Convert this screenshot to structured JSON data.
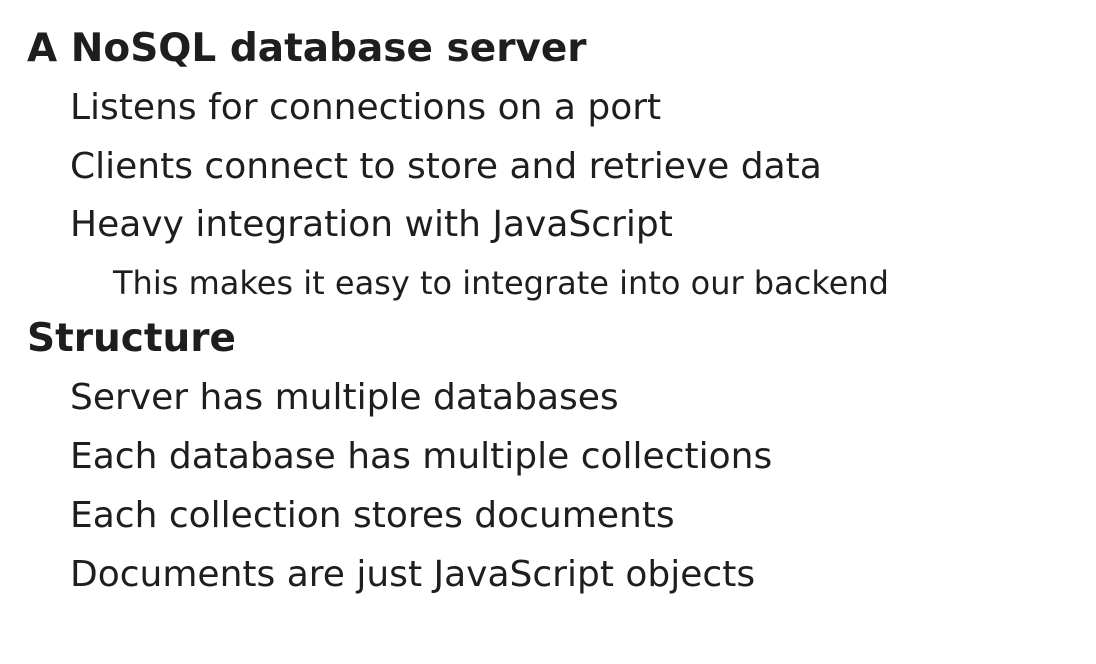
{
  "sections": [
    {
      "heading": "A NoSQL database server",
      "items": [
        "Listens for connections on a port",
        "Clients connect to store and retrieve data",
        "Heavy integration with JavaScript"
      ],
      "sub_items": [
        "This makes it easy to integrate into our backend"
      ]
    },
    {
      "heading": "Structure",
      "items": [
        "Server has multiple databases",
        "Each database has multiple collections",
        "Each collection stores documents",
        "Documents are just JavaScript objects"
      ]
    }
  ]
}
